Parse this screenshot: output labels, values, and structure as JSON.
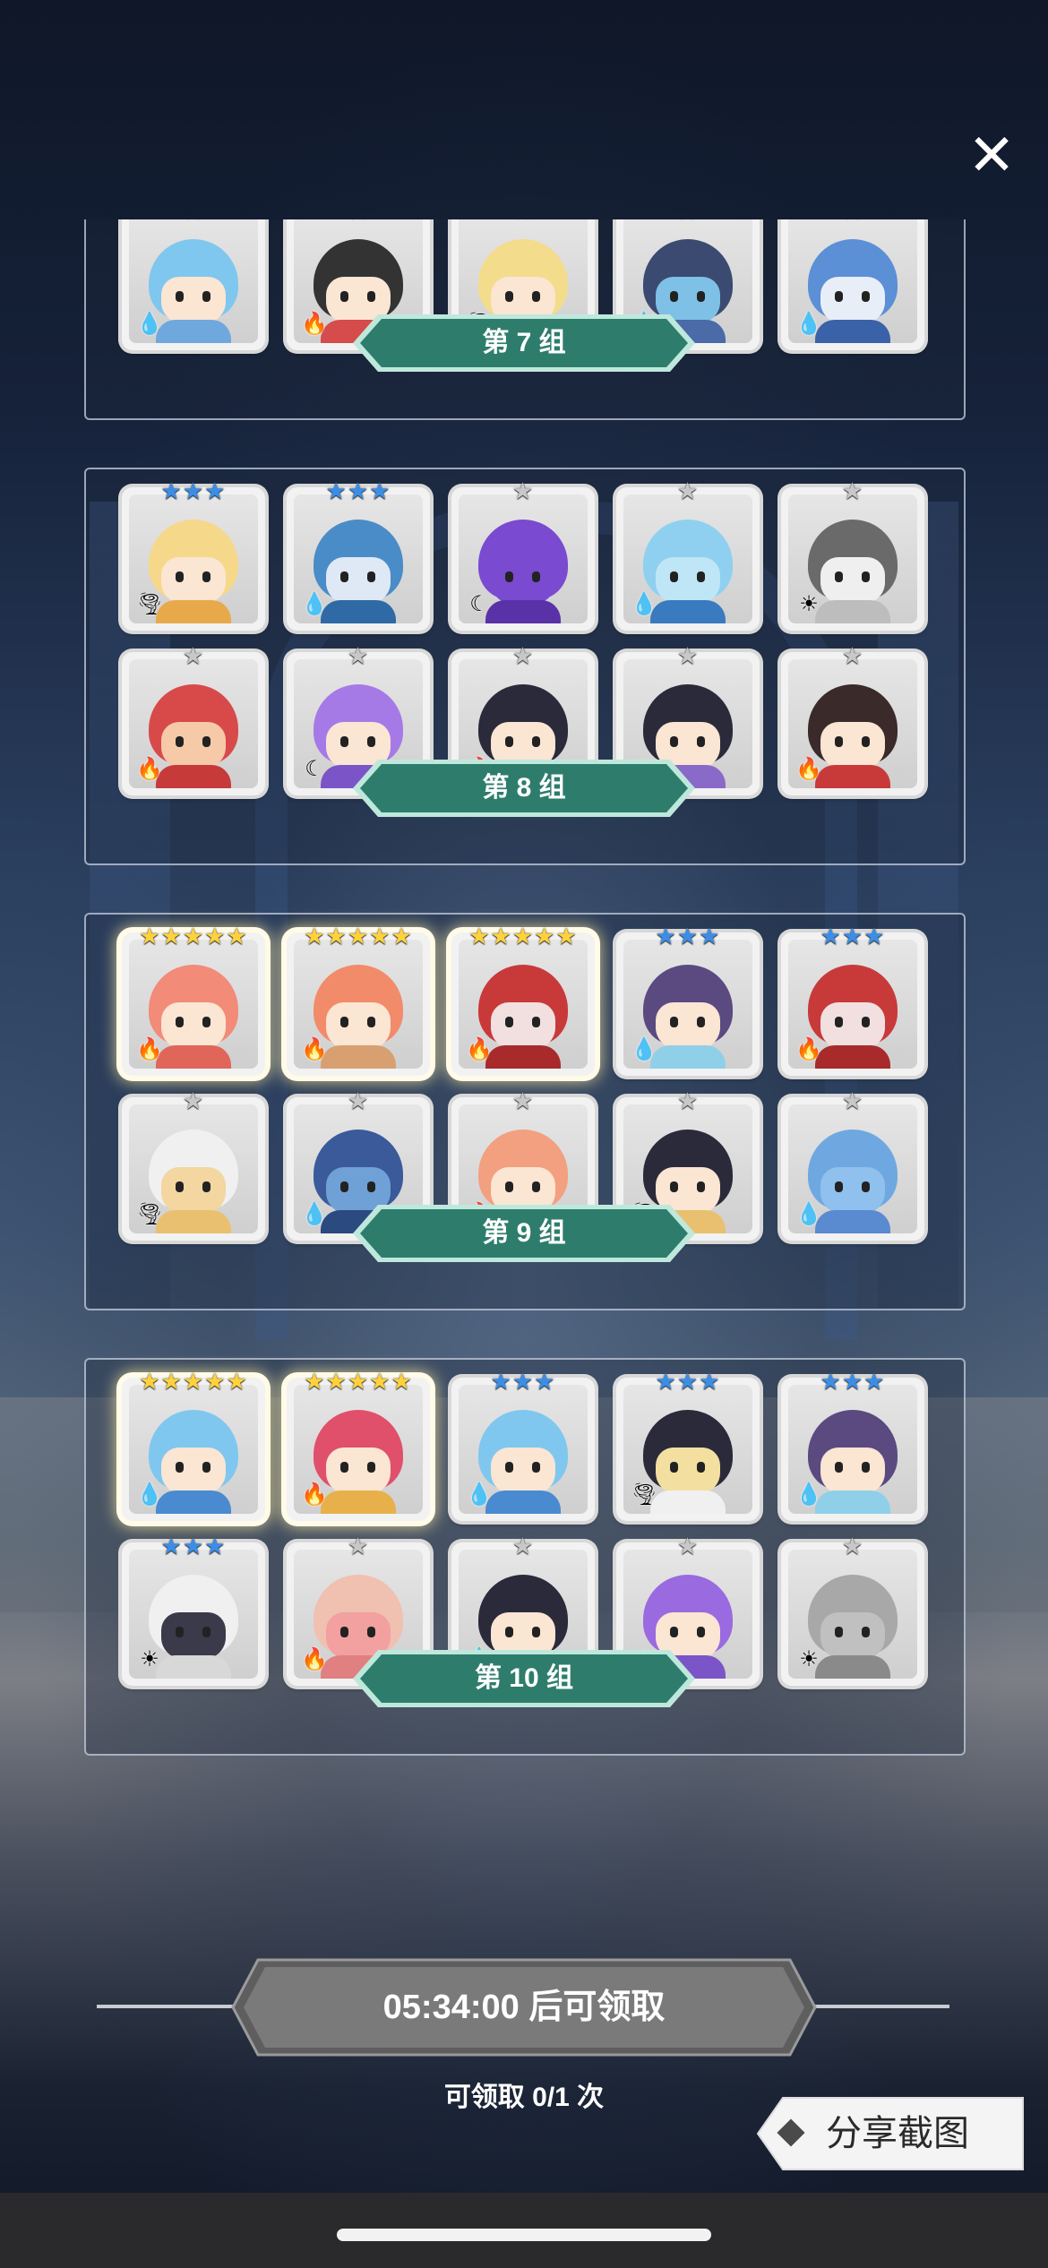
{
  "close_label": "✕",
  "groups": [
    {
      "label": "第 7 组",
      "heroes": [
        {
          "stars": "",
          "element": "water",
          "element_glyph": "💧",
          "hair": "#2a221e",
          "skin": "#fbe5d3",
          "body": "#3c5a9a",
          "gold": false
        },
        {
          "stars": "",
          "element": "water",
          "element_glyph": "💧",
          "hair": "#6fb6e6",
          "skin": "#6fb6e6",
          "body": "#3f7fbf",
          "gold": false
        },
        {
          "stars": "",
          "element": "light",
          "element_glyph": "☀",
          "hair": "#c9c9c9",
          "skin": "#e0e0e0",
          "body": "#9a9a9a",
          "gold": false
        },
        {
          "stars": "",
          "element": "dark",
          "element_glyph": "☾",
          "hair": "#8a5bd6",
          "skin": "#8a5bd6",
          "body": "#5b3aa0",
          "gold": false
        },
        {
          "stars": "",
          "element": "water",
          "element_glyph": "💧",
          "hair": "#7fc7e8",
          "skin": "#fbe5d3",
          "body": "#f2d27a",
          "gold": false
        },
        {
          "stars": "★",
          "element": "water",
          "element_glyph": "💧",
          "hair": "#7fc7ee",
          "skin": "#fbe5d3",
          "body": "#6fa8dc",
          "gold": false
        },
        {
          "stars": "★",
          "element": "fire",
          "element_glyph": "🔥",
          "hair": "#333333",
          "skin": "#fbe5d3",
          "body": "#d64b4b",
          "gold": false
        },
        {
          "stars": "★",
          "element": "earth",
          "element_glyph": "🌪",
          "hair": "#f3dc8c",
          "skin": "#fbe5d3",
          "body": "#f0f0f0",
          "gold": false
        },
        {
          "stars": "★",
          "element": "water",
          "element_glyph": "💧",
          "hair": "#3a4a70",
          "skin": "#7fc0e6",
          "body": "#4a6aa8",
          "gold": false
        },
        {
          "stars": "★",
          "element": "water",
          "element_glyph": "💧",
          "hair": "#5b8fd6",
          "skin": "#e8eef8",
          "body": "#3a62a8",
          "gold": false
        }
      ]
    },
    {
      "label": "第 8 组",
      "heroes": [
        {
          "stars": "★★★",
          "element": "earth",
          "element_glyph": "🌪",
          "hair": "#f6d88a",
          "skin": "#fbe5d3",
          "body": "#e8a94a",
          "gold": false
        },
        {
          "stars": "★★★",
          "element": "water",
          "element_glyph": "💧",
          "hair": "#4a8cc8",
          "skin": "#dfe9f5",
          "body": "#2f6aa6",
          "gold": false
        },
        {
          "stars": "★",
          "element": "dark",
          "element_glyph": "☾",
          "hair": "#7a4ad0",
          "skin": "#7a4ad0",
          "body": "#5a32a8",
          "gold": false
        },
        {
          "stars": "★",
          "element": "water",
          "element_glyph": "💧",
          "hair": "#8fd0f0",
          "skin": "#bfe6f6",
          "body": "#3a7abf",
          "gold": false
        },
        {
          "stars": "★",
          "element": "light",
          "element_glyph": "☀",
          "hair": "#6a6a6a",
          "skin": "#efefef",
          "body": "#bdbdbd",
          "gold": false
        },
        {
          "stars": "★",
          "element": "fire",
          "element_glyph": "🔥",
          "hair": "#d84a4a",
          "skin": "#f6c9a8",
          "body": "#c63a3a",
          "gold": false
        },
        {
          "stars": "★",
          "element": "dark",
          "element_glyph": "☾",
          "hair": "#a67ae6",
          "skin": "#fbe5d3",
          "body": "#7b55c7",
          "gold": false
        },
        {
          "stars": "★",
          "element": "fire",
          "element_glyph": "🔥",
          "hair": "#2a2a3a",
          "skin": "#fbe5d3",
          "body": "#f0f0f0",
          "gold": false
        },
        {
          "stars": "★",
          "element": "dark",
          "element_glyph": "☾",
          "hair": "#2a2a3a",
          "skin": "#fbe5d3",
          "body": "#8a6ac8",
          "gold": false
        },
        {
          "stars": "★",
          "element": "fire",
          "element_glyph": "🔥",
          "hair": "#3a2a2a",
          "skin": "#fbe5d3",
          "body": "#c83a3a",
          "gold": false
        }
      ]
    },
    {
      "label": "第 9 组",
      "heroes": [
        {
          "stars": "★★★★★",
          "element": "fire",
          "element_glyph": "🔥",
          "hair": "#f28b78",
          "skin": "#fbe5d3",
          "body": "#e0665a",
          "gold": true
        },
        {
          "stars": "★★★★★",
          "element": "fire",
          "element_glyph": "🔥",
          "hair": "#f28b6a",
          "skin": "#fbe5d3",
          "body": "#d8a070",
          "gold": true
        },
        {
          "stars": "★★★★★",
          "element": "fire",
          "element_glyph": "🔥",
          "hair": "#c83a3a",
          "skin": "#f2e0e0",
          "body": "#a82a2a",
          "gold": true
        },
        {
          "stars": "★★★",
          "element": "water",
          "element_glyph": "💧",
          "hair": "#5a4a80",
          "skin": "#fbe5d3",
          "body": "#8fd0e8",
          "gold": false
        },
        {
          "stars": "★★★",
          "element": "fire",
          "element_glyph": "🔥",
          "hair": "#c83a3a",
          "skin": "#f2e0e0",
          "body": "#a82a2a",
          "gold": false
        },
        {
          "stars": "★",
          "element": "earth",
          "element_glyph": "🌪",
          "hair": "#f0f0f0",
          "skin": "#f3d6a0",
          "body": "#e8c070",
          "gold": false
        },
        {
          "stars": "★",
          "element": "water",
          "element_glyph": "💧",
          "hair": "#3a5a9a",
          "skin": "#6fa0d6",
          "body": "#2a4a80",
          "gold": false
        },
        {
          "stars": "★",
          "element": "fire",
          "element_glyph": "🔥",
          "hair": "#f2a080",
          "skin": "#fbe5d3",
          "body": "#d86a4a",
          "gold": false
        },
        {
          "stars": "★",
          "element": "earth",
          "element_glyph": "🌪",
          "hair": "#2a2a3a",
          "skin": "#fbe5d3",
          "body": "#e8c070",
          "gold": false
        },
        {
          "stars": "★",
          "element": "water",
          "element_glyph": "💧",
          "hair": "#6fa8e0",
          "skin": "#8fc0ee",
          "body": "#5a8ad0",
          "gold": false
        }
      ]
    },
    {
      "label": "第 10 组",
      "heroes": [
        {
          "stars": "★★★★★",
          "element": "water",
          "element_glyph": "💧",
          "hair": "#7fc7ee",
          "skin": "#fbe5d3",
          "body": "#4a8ad0",
          "gold": true
        },
        {
          "stars": "★★★★★",
          "element": "fire",
          "element_glyph": "🔥",
          "hair": "#e0506a",
          "skin": "#fbe5d3",
          "body": "#e8b04a",
          "gold": true
        },
        {
          "stars": "★★★",
          "element": "water",
          "element_glyph": "💧",
          "hair": "#7fc7ee",
          "skin": "#fbe5d3",
          "body": "#4a8ad0",
          "gold": false
        },
        {
          "stars": "★★★",
          "element": "earth",
          "element_glyph": "🌪",
          "hair": "#2a2a3a",
          "skin": "#f3e0a0",
          "body": "#f0f0f0",
          "gold": false
        },
        {
          "stars": "★★★",
          "element": "water",
          "element_glyph": "💧",
          "hair": "#5a4a80",
          "skin": "#fbe5d3",
          "body": "#8fd0e8",
          "gold": false
        },
        {
          "stars": "★★★",
          "element": "light",
          "element_glyph": "☀",
          "hair": "#f0f0f0",
          "skin": "#3a3a4a",
          "body": "#d8d8d8",
          "gold": false
        },
        {
          "stars": "★",
          "element": "fire",
          "element_glyph": "🔥",
          "hair": "#f0c0b0",
          "skin": "#f2a0a0",
          "body": "#e08080",
          "gold": false
        },
        {
          "stars": "★",
          "element": "water",
          "element_glyph": "💧",
          "hair": "#2a2a3a",
          "skin": "#fbe5d3",
          "body": "#4a8ad0",
          "gold": false
        },
        {
          "stars": "★",
          "element": "dark",
          "element_glyph": "☾",
          "hair": "#9a6ae0",
          "skin": "#fbe5d3",
          "body": "#7b55c7",
          "gold": false
        },
        {
          "stars": "★",
          "element": "light",
          "element_glyph": "☀",
          "hair": "#a8a8a8",
          "skin": "#c0c0c0",
          "body": "#8a8a8a",
          "gold": false
        }
      ]
    }
  ],
  "claim": {
    "button_label": "05:34:00 后可领取",
    "count_text": "可领取 0/1 次"
  },
  "share": {
    "label": "分享截图"
  },
  "colors": {
    "group_label_fill": "#2e7d6c",
    "group_label_border": "#bfe8dc",
    "claim_fill": "#6e6e6e",
    "star_blue": "#3a8ee8",
    "star_gold": "#ffd23a",
    "star_silver": "#c8c8c8"
  }
}
